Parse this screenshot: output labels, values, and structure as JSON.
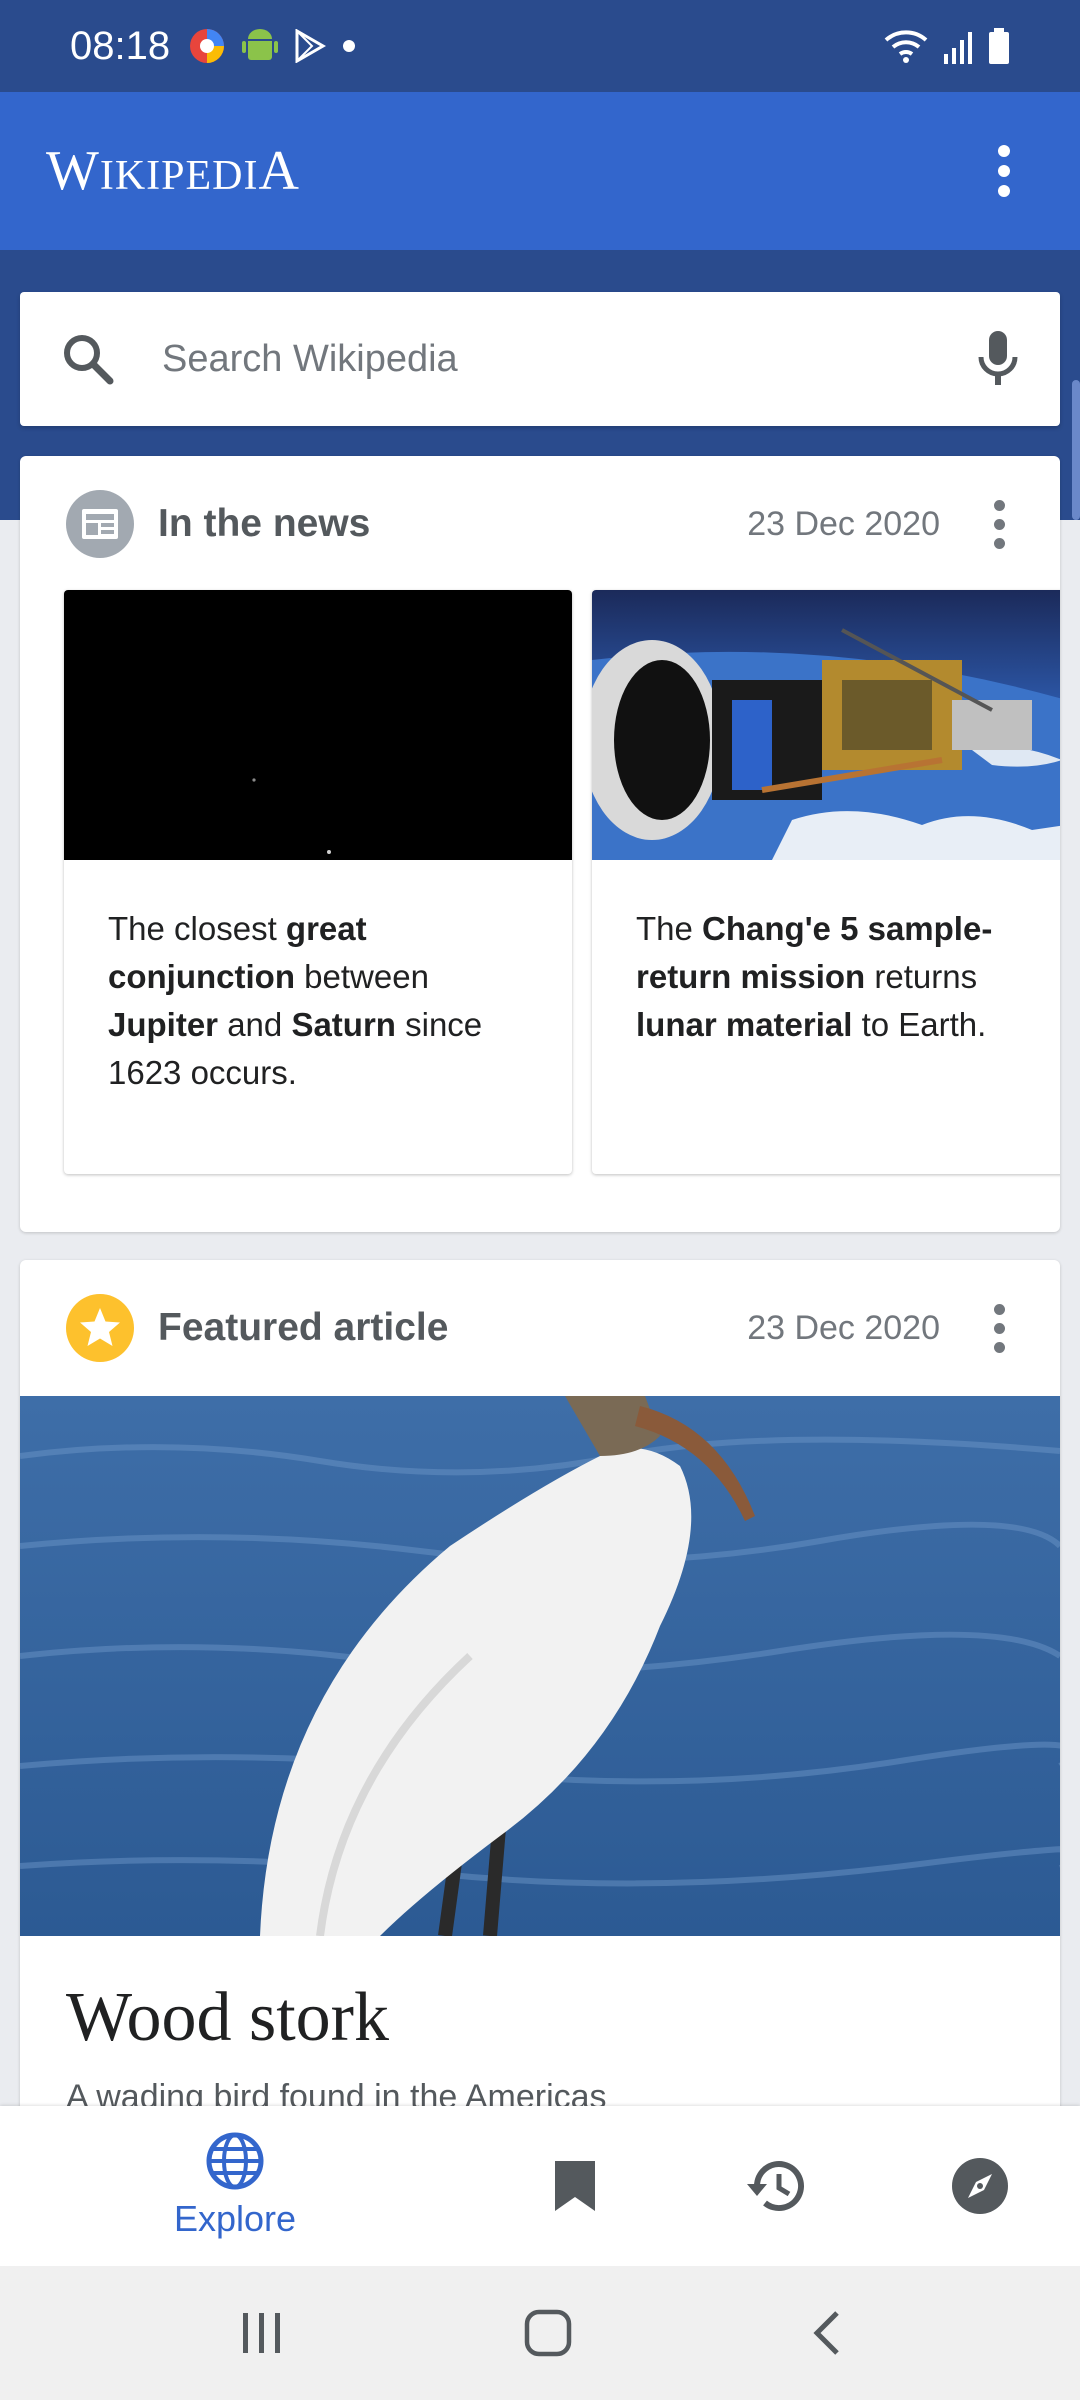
{
  "status_bar": {
    "time": "08:18"
  },
  "app_bar": {
    "wordmark_big_w": "W",
    "wordmark_small_1": "IKIPEDI",
    "wordmark_big_a": "A"
  },
  "search": {
    "placeholder": "Search Wikipedia"
  },
  "in_the_news": {
    "title": "In the news",
    "date": "23 Dec 2020",
    "items": [
      {
        "parts": [
          "The closest ",
          "great conjunction",
          " between ",
          "Jupiter",
          " and ",
          "Saturn",
          " since 1623 occurs."
        ]
      },
      {
        "parts": [
          "The ",
          "Chang'e 5 sample-return mission",
          " returns ",
          "lunar material",
          " to Earth."
        ]
      }
    ]
  },
  "featured_article": {
    "title": "Featured article",
    "date": "23 Dec 2020",
    "article_title": "Wood stork",
    "description": "A wading bird found in the Americas"
  },
  "bottom_nav": {
    "explore_label": "Explore"
  },
  "colors": {
    "brand_blue": "#3366cc",
    "dark_blue": "#2a4b8d",
    "star_yellow": "#fdc12d"
  }
}
